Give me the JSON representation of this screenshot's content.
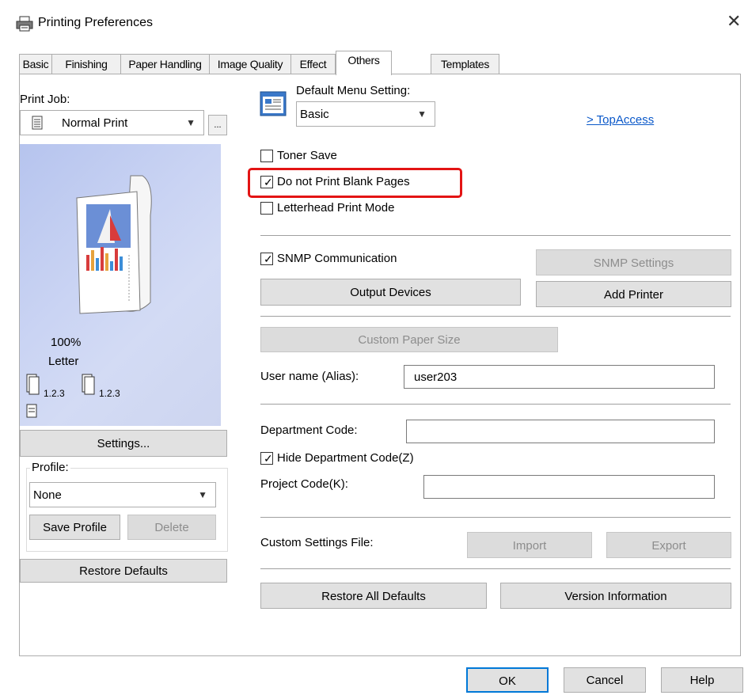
{
  "window": {
    "title": "Printing Preferences",
    "close_glyph": "✕"
  },
  "tabs": [
    {
      "label": "Basic"
    },
    {
      "label": "Finishing"
    },
    {
      "label": "Paper Handling"
    },
    {
      "label": "Image Quality"
    },
    {
      "label": "Effect"
    },
    {
      "label": "Others"
    },
    {
      "label": "Templates"
    }
  ],
  "left": {
    "print_job_label": "Print Job:",
    "print_job_value": "Normal Print",
    "more_button": "...",
    "preview": {
      "zoom": "100%",
      "paper": "Letter",
      "collate1": "1.2.3",
      "collate2": "1.2.3"
    },
    "settings_button": "Settings...",
    "profile_label": "Profile:",
    "profile_value": "None",
    "save_profile_button": "Save Profile",
    "delete_button": "Delete",
    "restore_defaults_button": "Restore Defaults"
  },
  "right": {
    "default_menu_label": "Default Menu Setting:",
    "default_menu_value": "Basic",
    "topaccess_link": "> TopAccess",
    "toner_save": {
      "label": "Toner Save",
      "checked": false
    },
    "blank_pages": {
      "label": "Do not Print Blank Pages",
      "checked": true
    },
    "letterhead": {
      "label": "Letterhead Print Mode",
      "checked": false
    },
    "snmp": {
      "label": "SNMP Communication",
      "checked": true
    },
    "snmp_settings_button": "SNMP Settings",
    "output_devices_button": "Output Devices",
    "add_printer_button": "Add Printer",
    "custom_paper_button": "Custom Paper Size",
    "username_label": "User name (Alias):",
    "username_value": "user203",
    "dept_code_label": "Department Code:",
    "dept_code_value": "",
    "hide_dept": {
      "label": "Hide Department Code(Z)",
      "checked": true
    },
    "project_code_label": "Project Code(K):",
    "project_code_value": "",
    "custom_file_label": "Custom Settings File:",
    "import_button": "Import",
    "export_button": "Export",
    "restore_all_button": "Restore All Defaults",
    "version_button": "Version Information"
  },
  "footer": {
    "ok": "OK",
    "cancel": "Cancel",
    "help": "Help"
  },
  "colors": {
    "highlight_box": "#e31414",
    "link": "#0a58c9",
    "button_face": "#e1e1e1"
  }
}
